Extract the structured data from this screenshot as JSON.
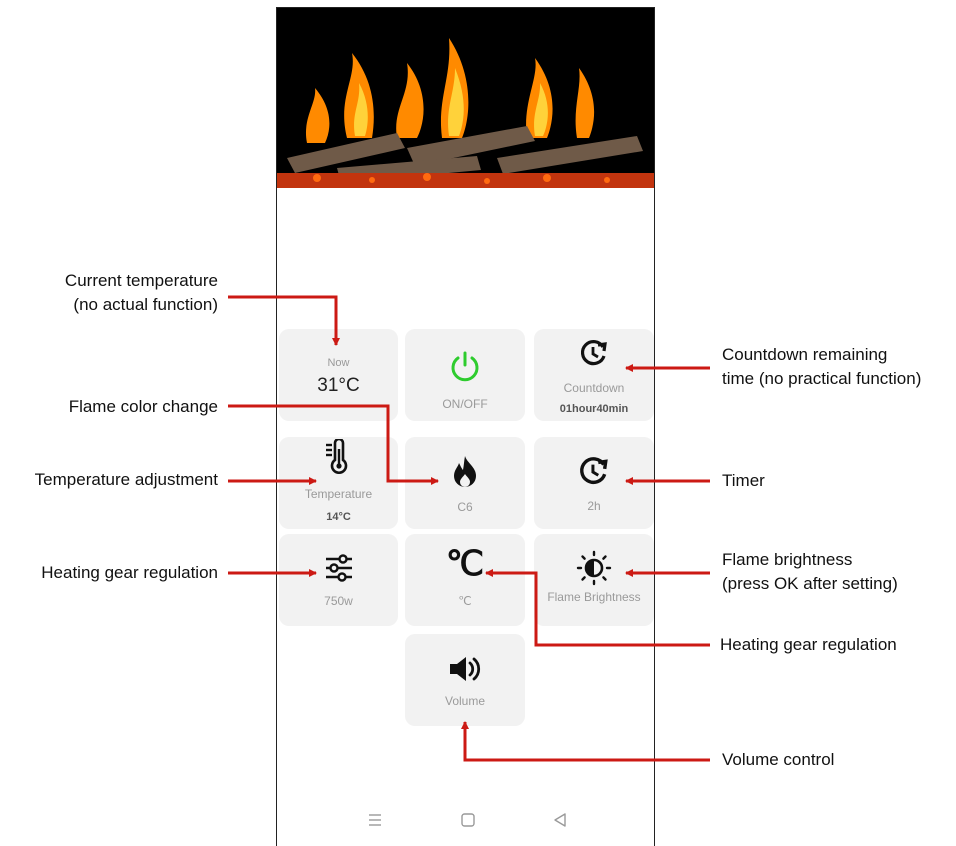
{
  "tiles": {
    "now": {
      "label": "Now",
      "value": "31°C"
    },
    "power": {
      "label": "ON/OFF",
      "color": "#2ecc2e"
    },
    "countdown": {
      "label": "Countdown",
      "value": "01hour40min"
    },
    "temperature": {
      "label": "Temperature",
      "value": "14°C"
    },
    "flame_color": {
      "label": "C6"
    },
    "timer": {
      "label": "2h"
    },
    "heat_gear": {
      "label": "750w"
    },
    "unit": {
      "icon_text": "℃",
      "label": "℃"
    },
    "brightness": {
      "label": "Flame Brightness"
    },
    "volume": {
      "label": "Volume"
    }
  },
  "annotations": {
    "current_temp_line1": "Current temperature",
    "current_temp_line2": "(no actual function)",
    "flame_color": "Flame color change",
    "temp_adjust": "Temperature adjustment",
    "heating_gear_left": "Heating gear regulation",
    "countdown_line1": "Countdown remaining",
    "countdown_line2": "time (no practical function)",
    "timer": "Timer",
    "brightness_line1": "Flame brightness",
    "brightness_line2": "(press OK after setting)",
    "heating_gear_right": "Heating gear regulation",
    "volume": "Volume control"
  },
  "colors": {
    "arrow": "#cc1a14",
    "tile_bg": "#f2f2f2",
    "label": "#9a9a9a"
  }
}
